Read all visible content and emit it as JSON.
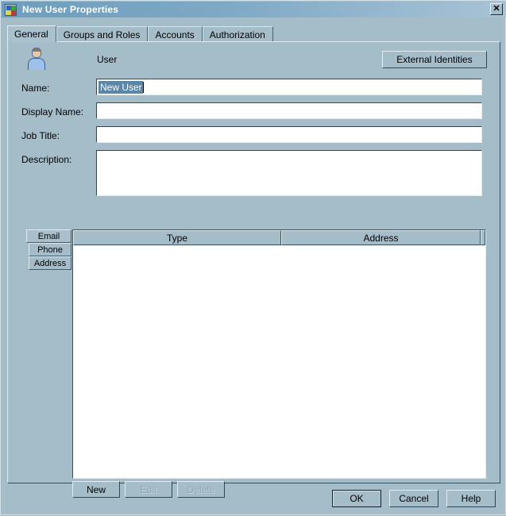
{
  "window": {
    "title": "New User Properties",
    "icon": "application-icon",
    "close_label": "✕"
  },
  "tabs": [
    {
      "label": "General",
      "selected": true
    },
    {
      "label": "Groups and Roles",
      "selected": false
    },
    {
      "label": "Accounts",
      "selected": false
    },
    {
      "label": "Authorization",
      "selected": false
    }
  ],
  "general": {
    "user_icon": "user-icon",
    "entity_type": "User",
    "external_identities_label": "External Identities",
    "fields": {
      "name": {
        "label": "Name:",
        "value": "New User",
        "selected": true,
        "placeholder": ""
      },
      "display_name": {
        "label": "Display Name:",
        "value": "",
        "placeholder": ""
      },
      "job_title": {
        "label": "Job Title:",
        "value": "",
        "placeholder": ""
      },
      "description": {
        "label": "Description:",
        "value": "",
        "placeholder": ""
      }
    },
    "contacts": {
      "side_tabs": [
        {
          "label": "Email",
          "selected": true
        },
        {
          "label": "Phone",
          "selected": false
        },
        {
          "label": "Address",
          "selected": false
        }
      ],
      "columns": [
        "Type",
        "Address"
      ],
      "rows": [],
      "buttons": [
        {
          "label": "New",
          "enabled": true
        },
        {
          "label": "Edit",
          "enabled": false
        },
        {
          "label": "Delete",
          "enabled": false
        }
      ]
    }
  },
  "footer": {
    "ok_label": "OK",
    "cancel_label": "Cancel",
    "help_label": "Help"
  },
  "colors": {
    "window_background": "#a5bcc9",
    "titlebar_start": "#6e9dbd",
    "titlebar_end": "#a8c3d6",
    "title_text": "#ffffff",
    "field_background": "#ffffff",
    "selection_background": "#5a86a8",
    "selection_text": "#ffffff",
    "disabled_text": "#8fa6b4",
    "border_dark": "#2d4856",
    "border_light": "#e2edf3"
  }
}
